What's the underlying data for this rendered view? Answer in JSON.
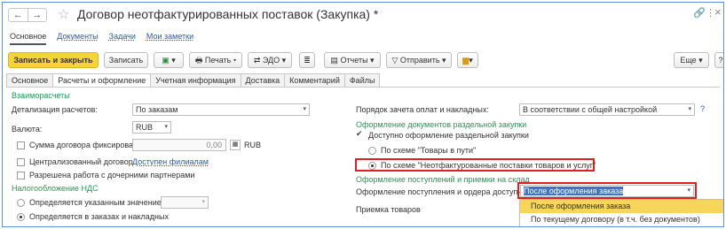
{
  "window": {
    "title": "Договор неотфактурированных поставок (Закупка) *",
    "back": "←",
    "forward": "→",
    "star": "☆",
    "link_icon": "🔗",
    "menu_icon": "⋮",
    "close_icon": "×"
  },
  "top_tabs": [
    "Основное",
    "Документы",
    "Задачи",
    "Мои заметки"
  ],
  "toolbar": {
    "save_close": "Записать и закрыть",
    "save": "Записать",
    "print": "Печать",
    "edo": "ЭДО",
    "reports": "Отчеты",
    "send": "Отправить",
    "more": "Еще",
    "help": "?"
  },
  "subtabs": [
    "Основное",
    "Расчеты и оформление",
    "Учетная информация",
    "Доставка",
    "Комментарий",
    "Файлы"
  ],
  "left": {
    "section_settlements": "Взаиморасчеты",
    "detail_label": "Детализация расчетов:",
    "detail_value": "По заказам",
    "currency_label": "Валюта:",
    "currency_value": "RUB",
    "fixed_sum_label": "Сумма договора фиксирована",
    "fixed_sum_value": "0,00",
    "fixed_sum_currency": "RUB",
    "centralized_label": "Централизованный договор",
    "by_branches_link": "Доступен филиалам",
    "subsidiaries_label": "Разрешена работа с дочерними партнерами",
    "section_vat": "Налогообложение НДС",
    "vat_option1": "Определяется указанным значением",
    "vat_option2": "Определяется в заказах и накладных"
  },
  "right": {
    "offset_label": "Порядок зачета оплат и накладных:",
    "offset_value": "В соответствии с общей настройкой",
    "help_q": "?",
    "section_separate": "Оформление документов раздельной закупки",
    "separate_available": "Доступно оформление раздельной закупки",
    "scheme1": "По схеме \"Товары в пути\"",
    "scheme2": "По схеме \"Неотфактурованные поставки товаров и услуг\"",
    "section_receipts": "Оформление поступлений и приемки на склад",
    "receipt_label": "Оформление поступления и ордера доступно:",
    "receipt_value": "После оформления заказа",
    "acceptance_label": "Приемка товаров",
    "dropdown_options": [
      "После оформления заказа",
      "По текущему договору (в т.ч. без документов)"
    ]
  },
  "colors": {
    "accent_yellow": "#f5d437",
    "section_green": "#1f9c54",
    "highlight_red": "#e02020",
    "link_blue": "#2a5caa"
  }
}
